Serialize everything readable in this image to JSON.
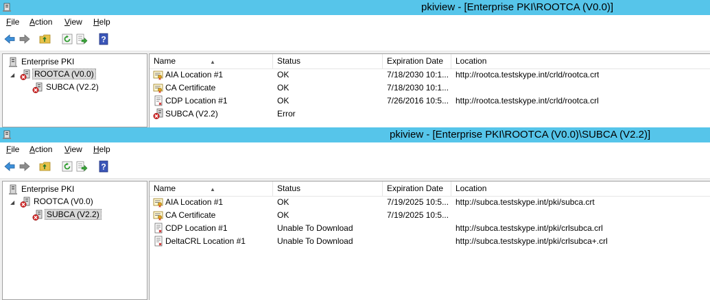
{
  "windows": [
    {
      "title": "pkiview - [Enterprise PKI\\ROOTCA (V0.0)]",
      "menu": [
        "File",
        "Action",
        "View",
        "Help"
      ],
      "menu_accel": [
        "F",
        "A",
        "V",
        "H"
      ],
      "toolbar_icons": [
        "back-arrow-icon",
        "forward-arrow-icon",
        "up-folder-icon",
        "refresh-icon",
        "export-list-icon",
        "help-icon"
      ],
      "tree": [
        {
          "label": "Enterprise PKI",
          "icon": "pki-root-icon",
          "selected": false
        },
        {
          "label": "ROOTCA (V0.0)",
          "icon": "ca-error-icon",
          "selected": true
        },
        {
          "label": "SUBCA (V2.2)",
          "icon": "ca-error-icon",
          "selected": false
        }
      ],
      "columns": [
        "Name",
        "Status",
        "Expiration Date",
        "Location"
      ],
      "rows": [
        {
          "icon": "cert-location-icon",
          "name": "AIA Location #1",
          "status": "OK",
          "expiration": "7/18/2030 10:1...",
          "location": "http://rootca.testskype.int/crld/rootca.crt"
        },
        {
          "icon": "cert-location-icon",
          "name": "CA Certificate",
          "status": "OK",
          "expiration": "7/18/2030 10:1...",
          "location": ""
        },
        {
          "icon": "crl-icon",
          "name": "CDP Location #1",
          "status": "OK",
          "expiration": "7/26/2016 10:5...",
          "location": "http://rootca.testskype.int/crld/rootca.crl"
        },
        {
          "icon": "ca-error-icon",
          "name": "SUBCA (V2.2)",
          "status": "Error",
          "expiration": "",
          "location": ""
        }
      ]
    },
    {
      "title": "pkiview - [Enterprise PKI\\ROOTCA (V0.0)\\SUBCA (V2.2)]",
      "menu": [
        "File",
        "Action",
        "View",
        "Help"
      ],
      "menu_accel": [
        "F",
        "A",
        "V",
        "H"
      ],
      "toolbar_icons": [
        "back-arrow-icon",
        "forward-arrow-icon",
        "up-folder-icon",
        "refresh-icon",
        "export-list-icon",
        "help-icon"
      ],
      "tree": [
        {
          "label": "Enterprise PKI",
          "icon": "pki-root-icon",
          "selected": false
        },
        {
          "label": "ROOTCA (V0.0)",
          "icon": "ca-error-icon",
          "selected": false
        },
        {
          "label": "SUBCA (V2.2)",
          "icon": "ca-error-icon",
          "selected": true
        }
      ],
      "columns": [
        "Name",
        "Status",
        "Expiration Date",
        "Location"
      ],
      "rows": [
        {
          "icon": "cert-location-icon",
          "name": "AIA Location #1",
          "status": "OK",
          "expiration": "7/19/2025 10:5...",
          "location": "http://subca.testskype.int/pki/subca.crt"
        },
        {
          "icon": "cert-location-icon",
          "name": "CA Certificate",
          "status": "OK",
          "expiration": "7/19/2025 10:5...",
          "location": ""
        },
        {
          "icon": "crl-icon",
          "name": "CDP Location #1",
          "status": "Unable To Download",
          "expiration": "",
          "location": "http://subca.testskype.int/pki/crlsubca.crl"
        },
        {
          "icon": "crl-icon",
          "name": "DeltaCRL Location #1",
          "status": "Unable To Download",
          "expiration": "",
          "location": "http://subca.testskype.int/pki/crlsubca+.crl"
        }
      ]
    }
  ]
}
